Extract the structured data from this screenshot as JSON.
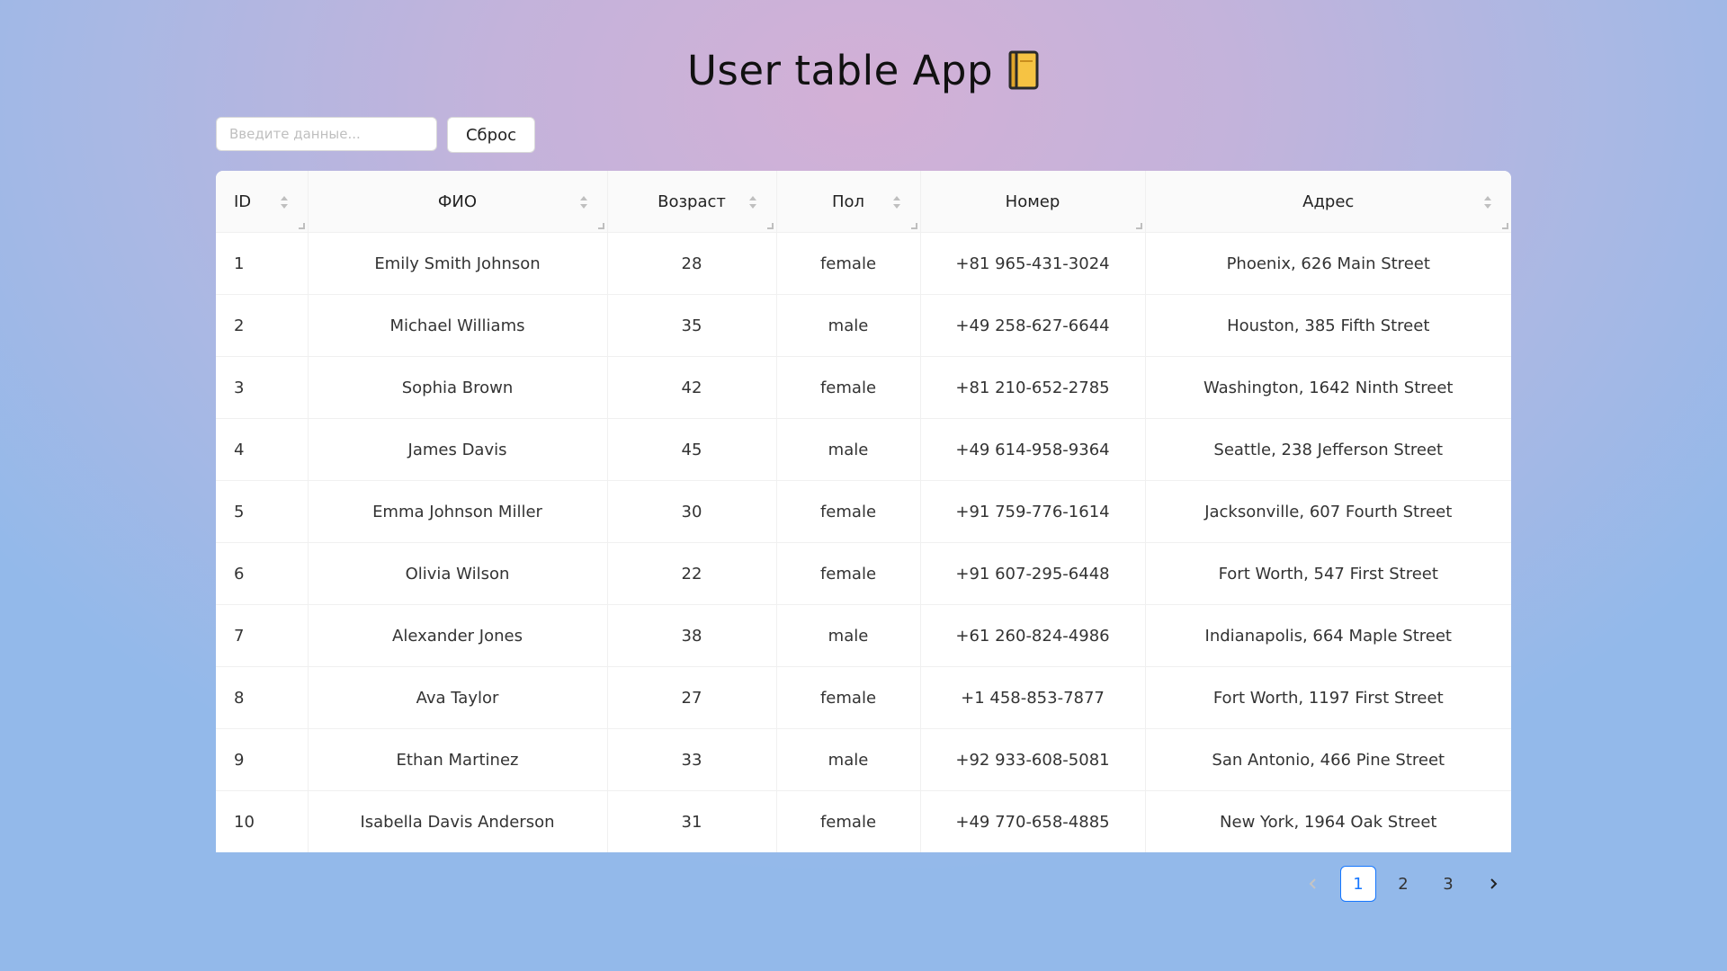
{
  "app": {
    "title": "User table App"
  },
  "search": {
    "placeholder": "Введите данные...",
    "value": ""
  },
  "reset_label": "Сброс",
  "table": {
    "columns": [
      {
        "label": "ID",
        "sortable": true
      },
      {
        "label": "ФИО",
        "sortable": true
      },
      {
        "label": "Возраст",
        "sortable": true
      },
      {
        "label": "Пол",
        "sortable": true
      },
      {
        "label": "Номер",
        "sortable": false
      },
      {
        "label": "Адрес",
        "sortable": true
      }
    ],
    "rows": [
      {
        "id": "1",
        "name": "Emily Smith Johnson",
        "age": "28",
        "gender": "female",
        "phone": "+81 965-431-3024",
        "address": "Phoenix, 626 Main Street"
      },
      {
        "id": "2",
        "name": "Michael Williams",
        "age": "35",
        "gender": "male",
        "phone": "+49 258-627-6644",
        "address": "Houston, 385 Fifth Street"
      },
      {
        "id": "3",
        "name": "Sophia Brown",
        "age": "42",
        "gender": "female",
        "phone": "+81 210-652-2785",
        "address": "Washington, 1642 Ninth Street"
      },
      {
        "id": "4",
        "name": "James Davis",
        "age": "45",
        "gender": "male",
        "phone": "+49 614-958-9364",
        "address": "Seattle, 238 Jefferson Street"
      },
      {
        "id": "5",
        "name": "Emma Johnson Miller",
        "age": "30",
        "gender": "female",
        "phone": "+91 759-776-1614",
        "address": "Jacksonville, 607 Fourth Street"
      },
      {
        "id": "6",
        "name": "Olivia Wilson",
        "age": "22",
        "gender": "female",
        "phone": "+91 607-295-6448",
        "address": "Fort Worth, 547 First Street"
      },
      {
        "id": "7",
        "name": "Alexander Jones",
        "age": "38",
        "gender": "male",
        "phone": "+61 260-824-4986",
        "address": "Indianapolis, 664 Maple Street"
      },
      {
        "id": "8",
        "name": "Ava Taylor",
        "age": "27",
        "gender": "female",
        "phone": "+1 458-853-7877",
        "address": "Fort Worth, 1197 First Street"
      },
      {
        "id": "9",
        "name": "Ethan Martinez",
        "age": "33",
        "gender": "male",
        "phone": "+92 933-608-5081",
        "address": "San Antonio, 466 Pine Street"
      },
      {
        "id": "10",
        "name": "Isabella Davis Anderson",
        "age": "31",
        "gender": "female",
        "phone": "+49 770-658-4885",
        "address": "New York, 1964 Oak Street"
      }
    ]
  },
  "pagination": {
    "prev_label": "‹",
    "next_label": "›",
    "pages": [
      "1",
      "2",
      "3"
    ],
    "current": "1"
  },
  "colors": {
    "accent": "#1677ff",
    "book_icon": "#f6c343"
  }
}
